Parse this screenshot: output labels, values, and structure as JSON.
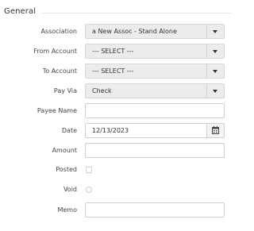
{
  "section": {
    "title": "General"
  },
  "fields": {
    "association": {
      "label": "Association",
      "value": "a New Assoc - Stand Alone",
      "icon": "chevron-down-icon"
    },
    "from_account": {
      "label": "From Account",
      "value": "--- SELECT ---",
      "icon": "chevron-down-icon"
    },
    "to_account": {
      "label": "To Account",
      "value": "--- SELECT ---",
      "icon": "chevron-down-icon"
    },
    "pay_via": {
      "label": "Pay Via",
      "value": "Check",
      "icon": "chevron-down-icon"
    },
    "payee_name": {
      "label": "Payee Name",
      "value": ""
    },
    "date": {
      "label": "Date",
      "value": "12/13/2023",
      "icon": "calendar-icon"
    },
    "amount": {
      "label": "Amount",
      "value": ""
    },
    "posted": {
      "label": "Posted",
      "checked": false
    },
    "void": {
      "label": "Void",
      "checked": false
    },
    "memo": {
      "label": "Memo",
      "value": ""
    }
  }
}
